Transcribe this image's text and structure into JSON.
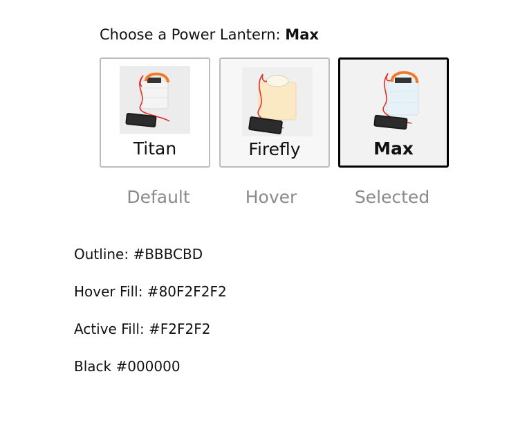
{
  "heading": {
    "prefix": "Choose a Power Lantern:",
    "selected": "Max"
  },
  "options": [
    {
      "name": "Titan",
      "state": "Default"
    },
    {
      "name": "Firefly",
      "state": "Hover"
    },
    {
      "name": "Max",
      "state": "Selected"
    }
  ],
  "specs": [
    "Outline: #BBBCBD",
    "Hover Fill: #80F2F2F2",
    "Active Fill: #F2F2F2",
    "Black #000000"
  ],
  "colors": {
    "outline": "#BBBCBD",
    "hover_fill": "#80F2F2F2",
    "active_fill": "#F2F2F2",
    "black": "#000000",
    "cord": "#e0332a",
    "handle": "#f07a2b"
  },
  "icons": [
    "lantern-image",
    "phone-icon"
  ]
}
